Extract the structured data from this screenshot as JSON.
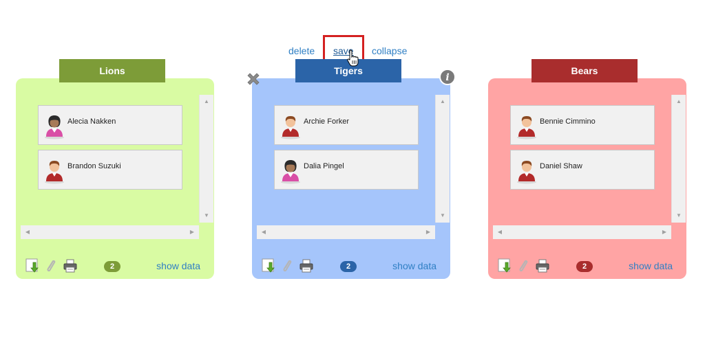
{
  "actions": {
    "delete": "delete",
    "save": "save",
    "collapse": "collapse"
  },
  "panels": [
    {
      "title": "Lions",
      "color": "#7d9c38",
      "bg": "#d9fba3",
      "members": [
        {
          "name": "Alecia Nakken",
          "avatar": "female"
        },
        {
          "name": "Brandon Suzuki",
          "avatar": "male"
        }
      ],
      "count": "2",
      "show_data": "show data"
    },
    {
      "title": "Tigers",
      "color": "#2b64a8",
      "bg": "#a5c5fb",
      "members": [
        {
          "name": "Archie Forker",
          "avatar": "male"
        },
        {
          "name": "Dalia Pingel",
          "avatar": "female"
        }
      ],
      "count": "2",
      "show_data": "show data"
    },
    {
      "title": "Bears",
      "color": "#a92d2d",
      "bg": "#ffa4a4",
      "members": [
        {
          "name": "Bennie Cimmino",
          "avatar": "male"
        },
        {
          "name": "Daniel Shaw",
          "avatar": "male"
        }
      ],
      "count": "2",
      "show_data": "show data"
    }
  ]
}
